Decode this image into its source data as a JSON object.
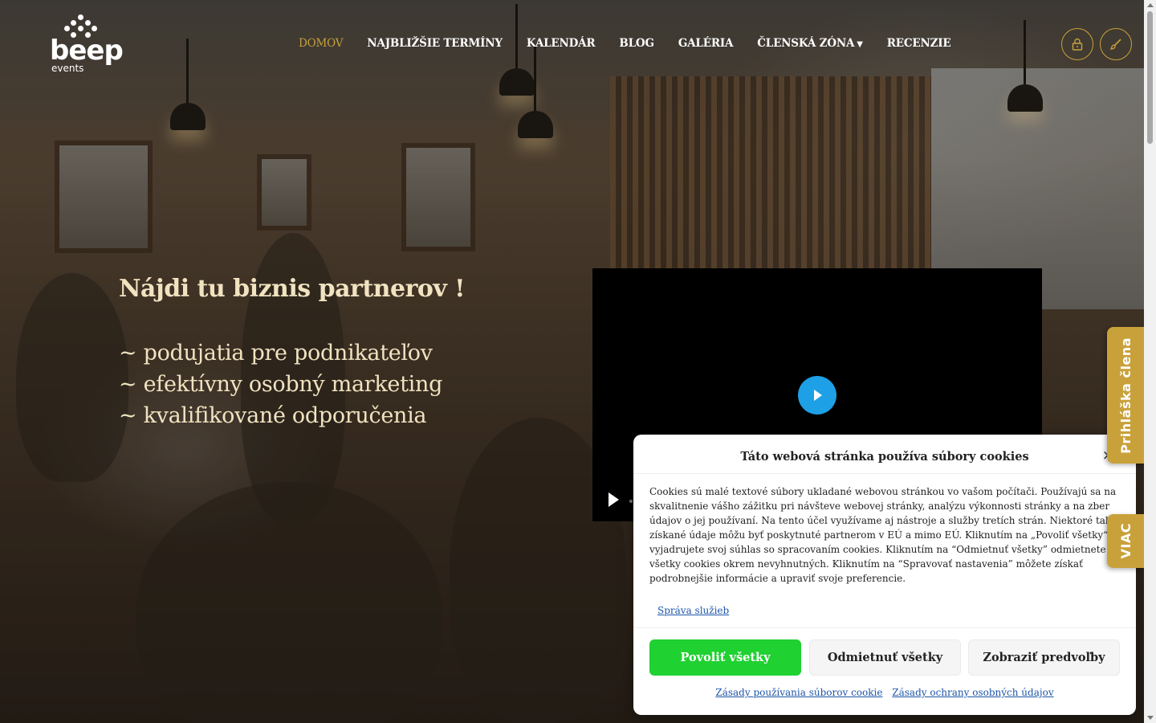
{
  "logo": {
    "word": "beep",
    "sub": "events"
  },
  "nav": {
    "items": [
      {
        "label": "DOMOV",
        "active": true
      },
      {
        "label": "NAJBLIŽŠIE TERMÍNY"
      },
      {
        "label": "KALENDÁR"
      },
      {
        "label": "BLOG"
      },
      {
        "label": "GALÉRIA"
      },
      {
        "label": "ČLENSKÁ ZÓNA",
        "dropdown": true
      },
      {
        "label": "RECENZIE"
      }
    ]
  },
  "header_icons": [
    "lock-icon",
    "brush-icon"
  ],
  "hero": {
    "headline": "Nájdi tu biznis partnerov !",
    "bullets": [
      "~ podujatia pre podnikateľov",
      "~ efektívny osobný marketing",
      "~ kvalifikované odporučenia"
    ]
  },
  "side_tabs": {
    "member": "Prihláška člena",
    "more": "VIAC"
  },
  "cookie": {
    "title": "Táto webová stránka používa súbory cookies",
    "close": "×",
    "body": "Cookies sú malé textové súbory ukladané webovou stránkou vo vašom počítači. Používajú sa na skvalitnenie vášho zážitku pri návšteve webovej stránky, analýzu výkonnosti stránky a na zber údajov o jej používaní. Na tento účel využívame aj nástroje a služby tretích strán. Niektoré takto získané údaje môžu byť poskytnuté partnerom v EÚ a mimo EÚ. Kliknutím na „Povoliť všetky“ vyjadrujete svoj súhlas so spracovaním cookies. Kliknutím na “Odmietnuť všetky” odmietnete všetky cookies okrem nevyhnutných. Kliknutím na “Spravovať nastavenia” môžete získať podrobnejšie informácie a upraviť svoje preferencie.",
    "manage_link": "Správa služieb",
    "accept": "Povoliť všetky",
    "deny": "Odmietnuť všetky",
    "prefs": "Zobraziť predvoľby",
    "policy_link": "Zásady používania súborov cookie",
    "privacy_link": "Zásady ochrany osobných údajov"
  },
  "colors": {
    "accent": "#c9a13b",
    "accept": "#1fd131",
    "play": "#1ea0e6",
    "hero_text": "#f1e3c0"
  }
}
